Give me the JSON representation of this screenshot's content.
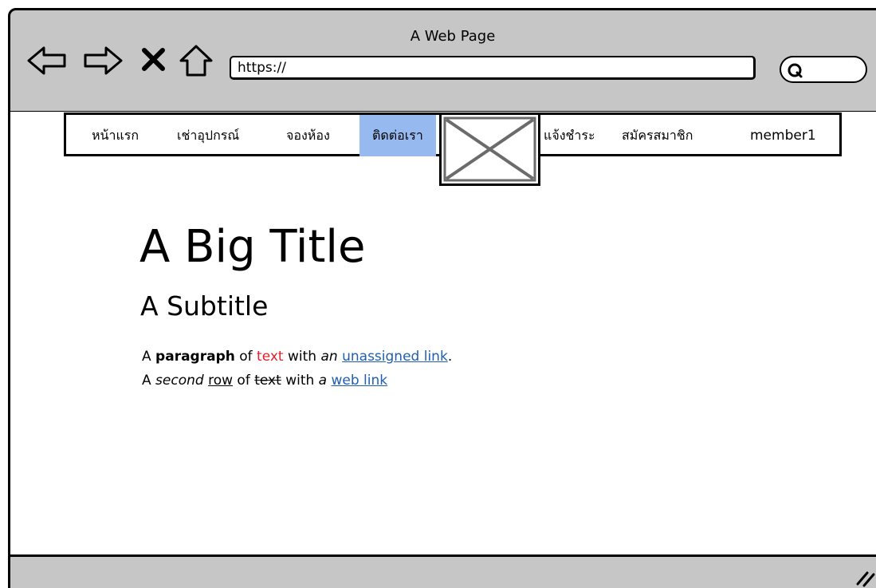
{
  "window": {
    "title": "A Web Page"
  },
  "toolbar": {
    "icons": [
      "back-arrow-icon",
      "forward-arrow-icon",
      "close-x-icon",
      "home-icon"
    ],
    "url": "https://",
    "search_icon": "search-icon"
  },
  "nav": {
    "items": [
      {
        "label": "หน้าแรก"
      },
      {
        "label": "เช่าอุปกรณ์"
      },
      {
        "label": "จองห้อง"
      },
      {
        "label": "ติดต่อเรา",
        "active": true
      },
      {
        "label": "แจ้งชำระ"
      },
      {
        "label": "สมัครสมาชิก"
      },
      {
        "label": "member1"
      }
    ],
    "active_color": "#96b9ef"
  },
  "main": {
    "title": "A Big Title",
    "subtitle": "A Subtitle",
    "line1": {
      "a": "A",
      "bold": "paragraph",
      "of": "of",
      "red": "text",
      "with_an": "with",
      "an": "an",
      "link": "unassigned link",
      "period": "."
    },
    "line2": {
      "a": "A",
      "italic": "second",
      "underlined": "row",
      "of": "of",
      "strike": "text",
      "with": "with",
      "italic_a": "a",
      "link": "web link"
    }
  },
  "colors": {
    "chrome": "#c6c6c6",
    "link": "#1f5fae",
    "red_text": "#e1212b"
  }
}
